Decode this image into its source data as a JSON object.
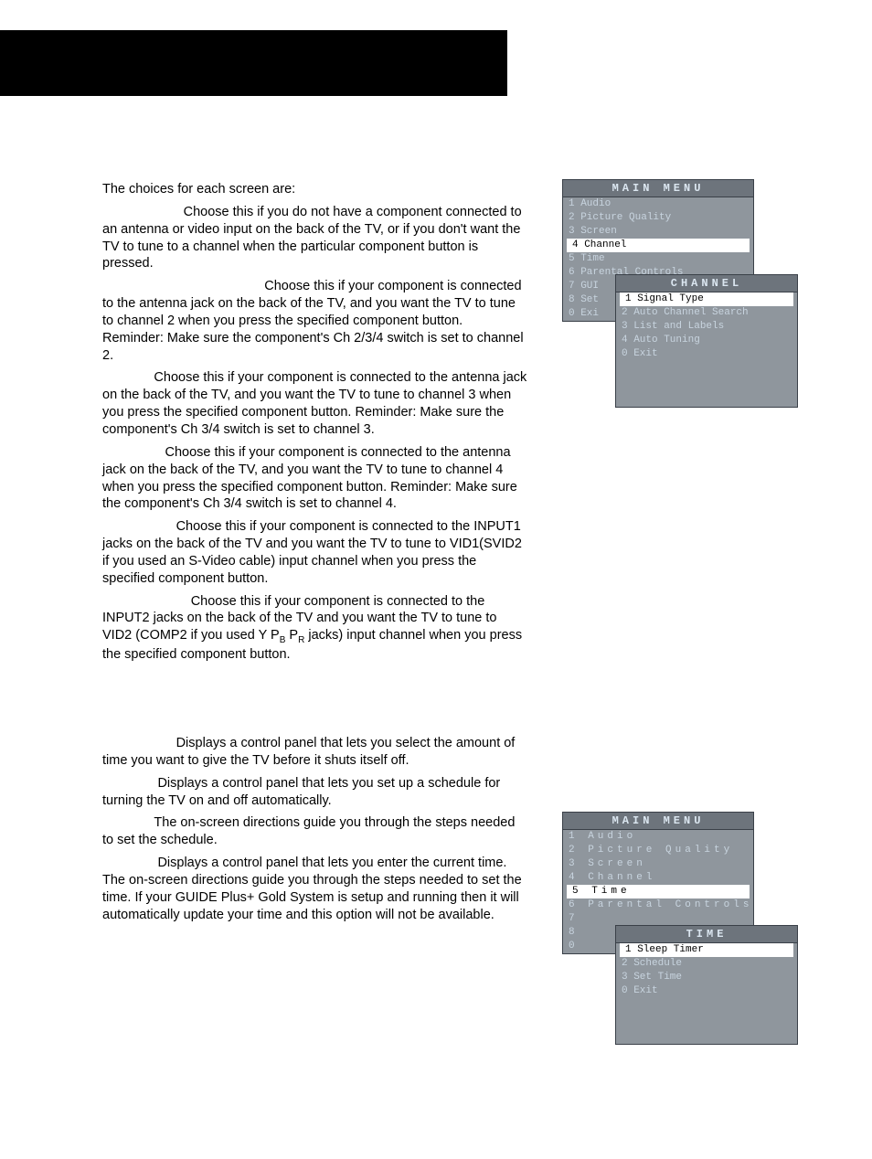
{
  "text": {
    "intro": "The choices for each screen are:",
    "nochange_body": "Choose this if you do not have a component connected to an antenna or video input on the back of the TV, or if you don't want the TV to tune to a channel when the particular component button is pressed.",
    "ant2_body": "Choose this if your component is connected to the antenna jack on the back of the TV, and you want the TV to tune to channel 2 when you press the specified component button. Reminder: Make sure the component's Ch 2/3/4 switch is set to channel 2.",
    "ant3_body": "Choose this if your component is connected to the antenna jack on the back of the TV, and you want the TV to tune to channel 3 when you press the specified component button. Reminder: Make sure the component's Ch 3/4 switch is set to channel 3.",
    "ant4_body": "Choose this if your component is connected to the antenna jack on the back of the TV, and you want the TV to tune to channel 4 when you press the specified component button. Reminder: Make sure the component's Ch 3/4 switch is set to channel 4.",
    "in1_body": "Choose this if your component is connected to the INPUT1 jacks on the back of the TV and you want the TV to tune to VID1(SVID2 if you used an S-Video cable) input channel when you press the specified component button.",
    "in2_pre": "Choose this if your component is connected to the INPUT2 jacks on the back of the TV and you want the TV to tune to VID2 (COMP2 if you used Y P",
    "in2_b": "B",
    "in2_mid": " P",
    "in2_r": "R",
    "in2_post": " jacks) input channel when you press the specified component button.",
    "sleep_body": "Displays a control panel that lets you select the amount of time you want to give the TV before it shuts itself off.",
    "sched_body": "Displays a control panel that lets you set up a schedule for turning the TV on and off automatically.",
    "sched_note": "The on-screen directions guide you through the steps needed to set the schedule.",
    "settime_body": "Displays a control panel that lets you enter the current time. The on-screen directions guide you through the steps needed to set the time. If your GUIDE Plus+ Gold System is setup and running then it will automatically update your time and this option will not be available."
  },
  "osd1": {
    "main_title": "MAIN MENU",
    "main_items": [
      "1 Audio",
      "2 Picture Quality",
      "3 Screen",
      "4 Channel",
      "5 Time",
      "6 Parental Controls",
      "7 GUI",
      "8 Set",
      "0 Exi"
    ],
    "sub_title": "CHANNEL",
    "sub_items": [
      "1 Signal Type",
      "2 Auto Channel Search",
      "3 List and Labels",
      "4 Auto Tuning",
      "0 Exit"
    ]
  },
  "osd2": {
    "main_title": "MAIN MENU",
    "main_items": [
      "1 Audio",
      "2 Picture Quality",
      "3 Screen",
      "4 Channel",
      "5 Time",
      "6 Parental Controls",
      "7",
      "8",
      "0"
    ],
    "sub_title": "TIME",
    "sub_items": [
      "1 Sleep Timer",
      "2 Schedule",
      "3 Set Time",
      "0 Exit"
    ]
  }
}
